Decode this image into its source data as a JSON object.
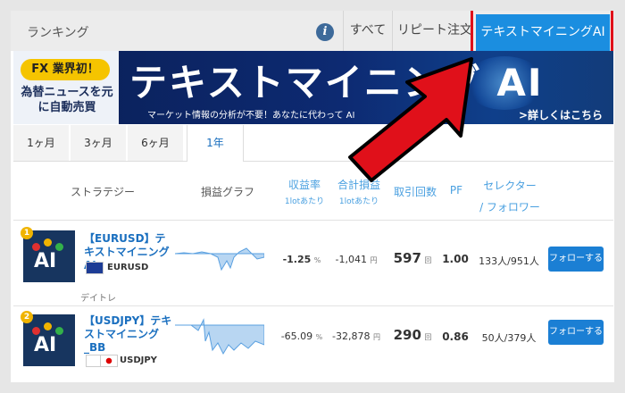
{
  "topbar": {
    "ranking": "ランキング",
    "info_icon": "i",
    "tabs": [
      "すべて",
      "リピート注文",
      "テキストマイニングAI"
    ]
  },
  "banner": {
    "badge": "FX 業界初！",
    "left_text": "為替ニュースを元に自動売買",
    "title": "テキストマイニング AI",
    "subtitle": "マーケット情報の分析が不要！あなたに代わって AI",
    "more": ">詳しくはこちら"
  },
  "periods": [
    "1ヶ月",
    "3ヶ月",
    "6ヶ月",
    "1年"
  ],
  "active_period": "1年",
  "columns": {
    "strategy": "ストラテジー",
    "graph": "損益グラフ",
    "return": "収益率",
    "return_sub": "1lotあたり",
    "total_pl": "合計損益",
    "total_pl_sub": "1lotあたり",
    "trades": "取引回数",
    "pf": "PF",
    "selector_line1": "セレクター",
    "selector_line2": "/ フォロワー"
  },
  "rows": [
    {
      "rank": "1",
      "logo_text": "AI",
      "name": "【EURUSD】テキストマイニングAI",
      "pair": "EURUSD",
      "return": "-1.25",
      "return_unit": "%",
      "pl": "-1,041",
      "pl_unit": "円",
      "trades": "597",
      "trades_unit": "回",
      "pf": "1.00",
      "selector": "133人/951人",
      "follow": "フォローする",
      "style": "デイトレ"
    },
    {
      "rank": "2",
      "logo_text": "AI",
      "name": "【USDJPY】テキストマイニング_BB",
      "pair": "USDJPY",
      "return": "-65.09",
      "return_unit": "%",
      "pl": "-32,878",
      "pl_unit": "円",
      "trades": "290",
      "trades_unit": "回",
      "pf": "0.86",
      "selector": "50人/379人",
      "follow": "フォローする"
    }
  ],
  "colors": {
    "accent": "#1b8ee0",
    "highlight_box": "#e0101a",
    "arrow": "#e0101a",
    "logo_bg": "#17355f"
  }
}
